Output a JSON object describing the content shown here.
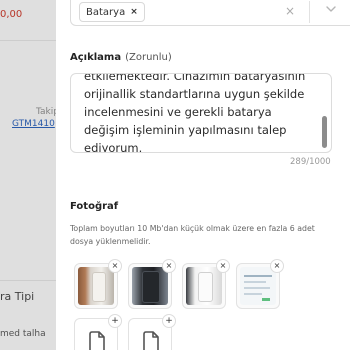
{
  "background": {
    "price": "0,00",
    "tracking_label": "Takip N",
    "tracking_link": "GTM1410",
    "section_title": "ra Tipi",
    "user_text": "med talha"
  },
  "form": {
    "select": {
      "selected_chip": "Batarya",
      "chip_remove": "×",
      "clear": "×"
    },
    "description": {
      "label": "Açıklama",
      "optional": "(Zorunlu)",
      "value": "etkilemektedir. Cihazımın bataryasının orijinallik standartlarına uygun şekilde incelenmesini ve gerekli batarya değişim işleminin yapılmasını talep ediyorum.",
      "counter": "289/1000"
    },
    "photos": {
      "title": "Fotoğraf",
      "hint": "Toplam boyutları 10 Mb'dan küçük olmak üzere en fazla 6 adet dosya yüklenmelidir.",
      "remove_label": "×",
      "add_label": "+"
    }
  },
  "colors": {
    "price_red": "#c0392b",
    "link_blue": "#2a5db0"
  }
}
